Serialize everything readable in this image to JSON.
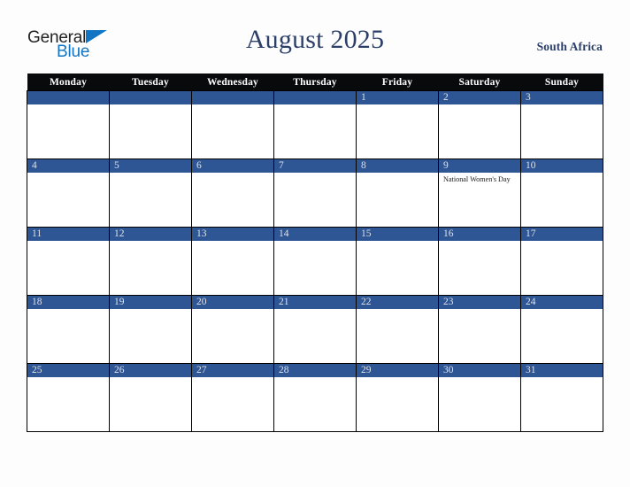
{
  "brand": {
    "name_part1": "General",
    "name_part2": "Blue",
    "triangle_icon": "triangle-icon",
    "accent_color": "#1275c4"
  },
  "header": {
    "title": "August 2025",
    "country": "South Africa",
    "title_color": "#2b3f69"
  },
  "calendar": {
    "month": "August",
    "year": "2025",
    "weekday_headers": [
      "Monday",
      "Tuesday",
      "Wednesday",
      "Thursday",
      "Friday",
      "Saturday",
      "Sunday"
    ],
    "header_bg": "#090a0c",
    "daynum_bg": "#2e5594",
    "daynum_color": "#dfe3ea",
    "weeks": [
      [
        {
          "day": "",
          "events": []
        },
        {
          "day": "",
          "events": []
        },
        {
          "day": "",
          "events": []
        },
        {
          "day": "",
          "events": []
        },
        {
          "day": "1",
          "events": []
        },
        {
          "day": "2",
          "events": []
        },
        {
          "day": "3",
          "events": []
        }
      ],
      [
        {
          "day": "4",
          "events": []
        },
        {
          "day": "5",
          "events": []
        },
        {
          "day": "6",
          "events": []
        },
        {
          "day": "7",
          "events": []
        },
        {
          "day": "8",
          "events": []
        },
        {
          "day": "9",
          "events": [
            "National Women's Day"
          ]
        },
        {
          "day": "10",
          "events": []
        }
      ],
      [
        {
          "day": "11",
          "events": []
        },
        {
          "day": "12",
          "events": []
        },
        {
          "day": "13",
          "events": []
        },
        {
          "day": "14",
          "events": []
        },
        {
          "day": "15",
          "events": []
        },
        {
          "day": "16",
          "events": []
        },
        {
          "day": "17",
          "events": []
        }
      ],
      [
        {
          "day": "18",
          "events": []
        },
        {
          "day": "19",
          "events": []
        },
        {
          "day": "20",
          "events": []
        },
        {
          "day": "21",
          "events": []
        },
        {
          "day": "22",
          "events": []
        },
        {
          "day": "23",
          "events": []
        },
        {
          "day": "24",
          "events": []
        }
      ],
      [
        {
          "day": "25",
          "events": []
        },
        {
          "day": "26",
          "events": []
        },
        {
          "day": "27",
          "events": []
        },
        {
          "day": "28",
          "events": []
        },
        {
          "day": "29",
          "events": []
        },
        {
          "day": "30",
          "events": []
        },
        {
          "day": "31",
          "events": []
        }
      ]
    ]
  }
}
